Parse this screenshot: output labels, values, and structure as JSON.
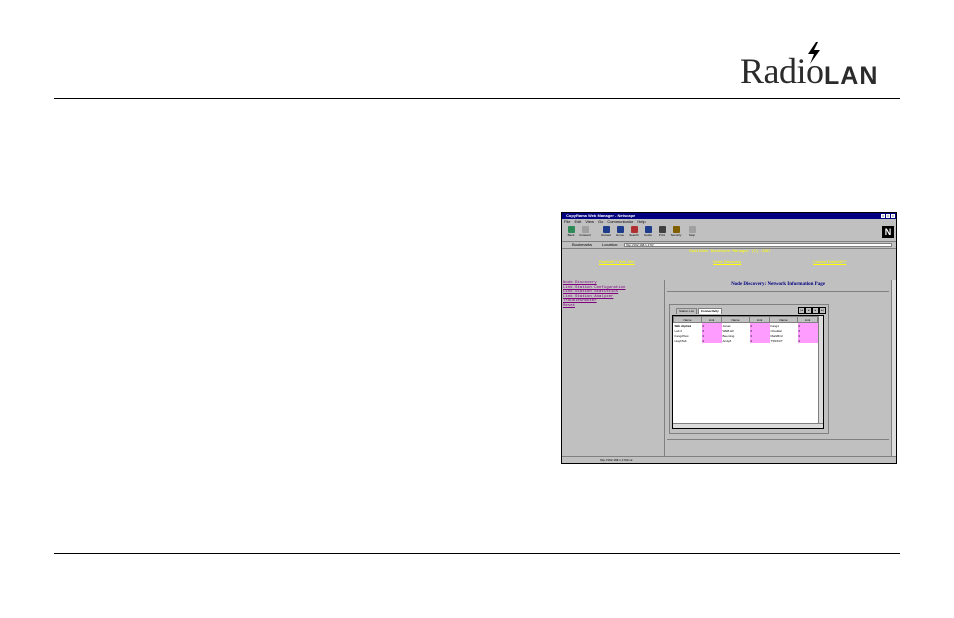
{
  "logo": {
    "text_part1": "Radio",
    "text_part2": "LAN"
  },
  "browser": {
    "title": "CopyRama Web Manager - Netscape",
    "menu": [
      "File",
      "Edit",
      "View",
      "Go",
      "Communicator",
      "Help"
    ],
    "toolbar": [
      "Back",
      "Forward",
      "Reload",
      "Home",
      "Search",
      "Guide",
      "Print",
      "Security",
      "Stop"
    ],
    "bookmarks_label": "Bookmarks",
    "location_label": "Location:",
    "location_url": "http://192.168.1.170/",
    "status_text": "http://192.168.1.170/nv2"
  },
  "banner": {
    "title": "RadioNet Backbone Manager (C) 1997",
    "links": [
      "RadioNET Web Site",
      "Node Discovery",
      "Contact RadioNET"
    ]
  },
  "leftnav": {
    "items": [
      "Node Discovery",
      "Link Station Configuration",
      "Link Station Statistics",
      "Link Station Analyzer",
      "Troubleshooter",
      "Reset"
    ]
  },
  "content": {
    "heading": "Node Discovery: Network Information Page",
    "tabs": [
      "Station List",
      "Connectivity"
    ],
    "columns": [
      "Name",
      "Link",
      "Name",
      "Link",
      "Name",
      "Link"
    ],
    "rows": [
      [
        "SBL Alpha1",
        "0",
        "Jonas",
        "0",
        "Fang1",
        "0"
      ],
      [
        "Lab 2",
        "0",
        "WEB HF",
        "0",
        "Cheddar",
        "0"
      ],
      [
        "Fang2Test",
        "0",
        "Beeming",
        "0",
        "MarkBird",
        "0"
      ],
      [
        "HughTab",
        "0",
        "AndyZ",
        "0",
        "TS5/KCT",
        "0"
      ]
    ]
  },
  "colors": {
    "link_cell": "#ff9cff",
    "banner_text": "#ffff00",
    "nav_link": "#800080",
    "titlebar": "#000080"
  }
}
